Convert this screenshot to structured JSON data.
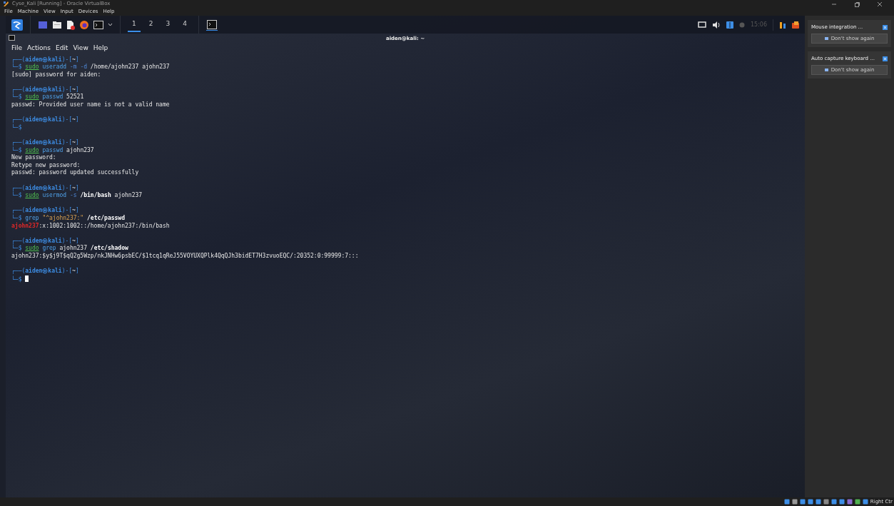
{
  "window": {
    "title": "Cyse_Kali [Running] - Oracle VirtualBox"
  },
  "menu": [
    "File",
    "Machine",
    "View",
    "Input",
    "Devices",
    "Help"
  ],
  "panel": {
    "workspaces": [
      {
        "label": "1",
        "selected": true
      },
      {
        "label": "2",
        "selected": false
      },
      {
        "label": "3",
        "selected": false
      },
      {
        "label": "4",
        "selected": false
      }
    ],
    "clock": "15:06"
  },
  "terminal": {
    "title": "aiden@kali: ~",
    "menu": [
      "File",
      "Actions",
      "Edit",
      "View",
      "Help"
    ],
    "blocks": [
      {
        "prompt": {
          "open": "┌──(",
          "user": "aiden",
          "at": "㉿",
          "host": "kali",
          "mid": ")-[",
          "dir": "~",
          "close": "]",
          "dollar": "└─$"
        },
        "command": [
          {
            "kind": "sudo",
            "text": "sudo"
          },
          {
            "kind": "cmd",
            "text": "useradd"
          },
          {
            "kind": "option",
            "text": "-m"
          },
          {
            "kind": "option",
            "text": "-d"
          },
          {
            "kind": "arg",
            "text": "/home/ajohn237"
          },
          {
            "kind": "arg",
            "text": "ajohn237"
          }
        ],
        "output": [
          [
            {
              "kind": "text",
              "text": "[sudo] password for aiden:"
            }
          ]
        ],
        "cursor": false
      },
      {
        "prompt": {
          "open": "┌──(",
          "user": "aiden",
          "at": "㉿",
          "host": "kali",
          "mid": ")-[",
          "dir": "~",
          "close": "]",
          "dollar": "└─$"
        },
        "command": [
          {
            "kind": "sudo",
            "text": "sudo"
          },
          {
            "kind": "cmd",
            "text": "passwd"
          },
          {
            "kind": "arg",
            "text": "52521"
          }
        ],
        "output": [
          [
            {
              "kind": "text",
              "text": "passwd: Provided user name is not a valid name"
            }
          ]
        ],
        "cursor": false
      },
      {
        "prompt": {
          "open": "┌──(",
          "user": "aiden",
          "at": "㉿",
          "host": "kali",
          "mid": ")-[",
          "dir": "~",
          "close": "]",
          "dollar": "└─$"
        },
        "cursor": false
      },
      {
        "prompt": {
          "open": "┌──(",
          "user": "aiden",
          "at": "㉿",
          "host": "kali",
          "mid": ")-[",
          "dir": "~",
          "close": "]",
          "dollar": "└─$"
        },
        "command": [
          {
            "kind": "sudo",
            "text": "sudo"
          },
          {
            "kind": "cmd",
            "text": "passwd"
          },
          {
            "kind": "arg",
            "text": "ajohn237"
          }
        ],
        "output": [
          [
            {
              "kind": "text",
              "text": "New password:"
            }
          ],
          [
            {
              "kind": "text",
              "text": "Retype new password:"
            }
          ],
          [
            {
              "kind": "text",
              "text": "passwd: password updated successfully"
            }
          ]
        ],
        "cursor": false
      },
      {
        "prompt": {
          "open": "┌──(",
          "user": "aiden",
          "at": "㉿",
          "host": "kali",
          "mid": ")-[",
          "dir": "~",
          "close": "]",
          "dollar": "└─$"
        },
        "command": [
          {
            "kind": "sudo",
            "text": "sudo"
          },
          {
            "kind": "cmd",
            "text": "usermod"
          },
          {
            "kind": "option",
            "text": "-s"
          },
          {
            "kind": "path",
            "text": "/bin/bash"
          },
          {
            "kind": "arg",
            "text": "ajohn237"
          }
        ],
        "cursor": false
      },
      {
        "prompt": {
          "open": "┌──(",
          "user": "aiden",
          "at": "㉿",
          "host": "kali",
          "mid": ")-[",
          "dir": "~",
          "close": "]",
          "dollar": "└─$"
        },
        "command": [
          {
            "kind": "cmd",
            "text": "grep"
          },
          {
            "kind": "string",
            "text": "\"^ajohn237:\""
          },
          {
            "kind": "path",
            "text": "/etc/passwd"
          }
        ],
        "output": [
          [
            {
              "kind": "match",
              "text": "ajohn237"
            },
            {
              "kind": "text",
              "text": ":x:1002:1002::/home/ajohn237:/bin/bash"
            }
          ]
        ],
        "cursor": false
      },
      {
        "prompt": {
          "open": "┌──(",
          "user": "aiden",
          "at": "㉿",
          "host": "kali",
          "mid": ")-[",
          "dir": "~",
          "close": "]",
          "dollar": "└─$"
        },
        "command": [
          {
            "kind": "sudo",
            "text": "sudo"
          },
          {
            "kind": "cmd",
            "text": "grep"
          },
          {
            "kind": "arg",
            "text": "ajohn237"
          },
          {
            "kind": "path",
            "text": "/etc/shadow"
          }
        ],
        "output": [
          [
            {
              "kind": "text",
              "text": "ajohn237:$y$j9T$qQ2g5Wzp/nkJNHw6psbEC/$1tcq1qReJ55VOYUXQPlk4QqQJh3bidET7H3zvuoEQC/:20352:0:99999:7:::"
            }
          ]
        ],
        "cursor": false
      },
      {
        "prompt": {
          "open": "┌──(",
          "user": "aiden",
          "at": "㉿",
          "host": "kali",
          "mid": ")-[",
          "dir": "~",
          "close": "]",
          "dollar": "└─$"
        },
        "cursor": true
      }
    ]
  },
  "notifications": [
    {
      "title": "Mouse integration ...",
      "button": "Don't show again"
    },
    {
      "title": "Auto capture keyboard ...",
      "button": "Don't show again"
    }
  ],
  "status_bar": {
    "host_key": "Right Ctr"
  }
}
